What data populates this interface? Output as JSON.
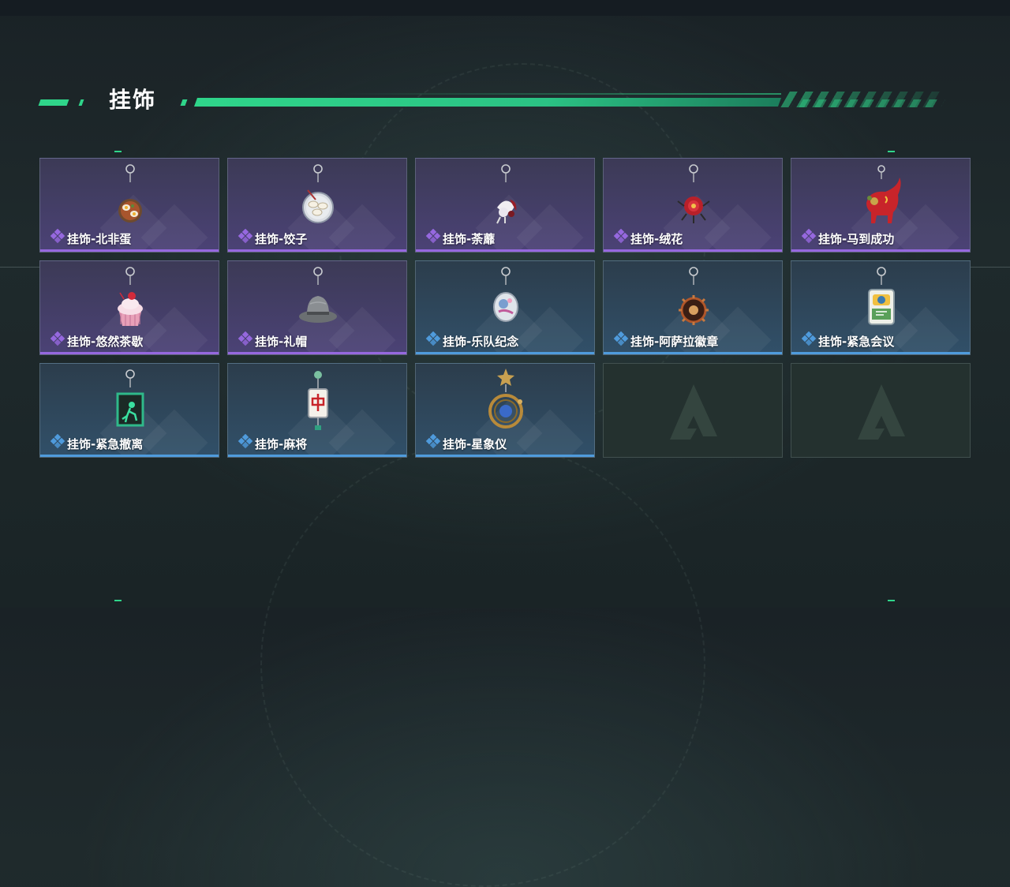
{
  "section": {
    "title": "挂饰"
  },
  "colors": {
    "accent": "#2fd58a",
    "rarity_purple": "#9668df",
    "rarity_blue": "#4f9bdc"
  },
  "items": [
    {
      "label": "挂饰-北非蛋",
      "rarity": "purple",
      "icon": "shakshuka-charm-icon"
    },
    {
      "label": "挂饰-饺子",
      "rarity": "purple",
      "icon": "dumpling-charm-icon"
    },
    {
      "label": "挂饰-荼蘼",
      "rarity": "purple",
      "icon": "flower-charm-icon"
    },
    {
      "label": "挂饰-绒花",
      "rarity": "purple",
      "icon": "velvet-flower-charm-icon"
    },
    {
      "label": "挂饰-马到成功",
      "rarity": "purple",
      "icon": "red-horse-charm-icon"
    },
    {
      "label": "挂饰-悠然茶歇",
      "rarity": "purple",
      "icon": "cupcake-charm-icon"
    },
    {
      "label": "挂饰-礼帽",
      "rarity": "purple",
      "icon": "hat-charm-icon"
    },
    {
      "label": "挂饰-乐队纪念",
      "rarity": "blue",
      "icon": "band-badge-charm-icon"
    },
    {
      "label": "挂饰-阿萨拉徽章",
      "rarity": "blue",
      "icon": "asara-badge-charm-icon"
    },
    {
      "label": "挂饰-紧急会议",
      "rarity": "blue",
      "icon": "emergency-meeting-charm-icon"
    },
    {
      "label": "挂饰-紧急撤离",
      "rarity": "blue",
      "icon": "emergency-exit-charm-icon"
    },
    {
      "label": "挂饰-麻将",
      "rarity": "blue",
      "icon": "mahjong-charm-icon"
    },
    {
      "label": "挂饰-星象仪",
      "rarity": "blue",
      "icon": "astrolabe-charm-icon"
    }
  ],
  "empty_slots": [
    {
      "icon": "delta-logo-icon"
    },
    {
      "icon": "delta-logo-icon"
    }
  ]
}
